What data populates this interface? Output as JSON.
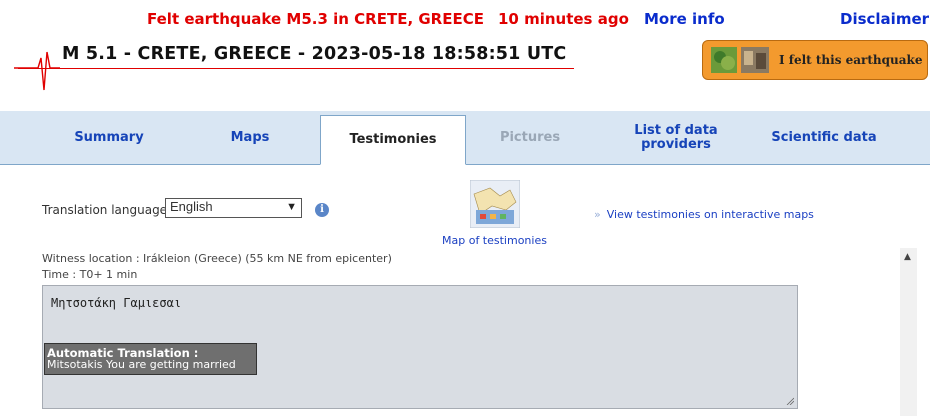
{
  "header": {
    "alert_text": "Felt earthquake M5.3 in CRETE, GREECE",
    "alert_time": "10 minutes ago",
    "more_info": "More info",
    "disclaimer": "Disclaimer",
    "event_title": "M 5.1 - CRETE, GREECE - 2023-05-18 18:58:51 UTC",
    "felt_button": "I felt this earthquake",
    "accent_red": "#e00000",
    "link_blue": "#0a2ccc"
  },
  "tabs": [
    {
      "label": "Summary",
      "state": "normal"
    },
    {
      "label": "Maps",
      "state": "normal"
    },
    {
      "label": "Testimonies",
      "state": "active"
    },
    {
      "label": "Pictures",
      "state": "disabled"
    },
    {
      "label": "List of data providers",
      "state": "normal"
    },
    {
      "label": "Scientific data",
      "state": "normal"
    }
  ],
  "controls": {
    "translation_label": "Translation language :",
    "language_selected": "English",
    "map_caption": "Map of testimonies",
    "view_link": "View testimonies on interactive maps"
  },
  "testimony": {
    "witness": "Witness location : Irákleion (Greece) (55 km NE from epicenter)",
    "time": "Time : T0+ 1 min",
    "original": "Μητσοτάκη Γαμιεσαι",
    "translation_heading": "Automatic Translation :",
    "translation_text": "Mitsotakis You are getting married"
  }
}
